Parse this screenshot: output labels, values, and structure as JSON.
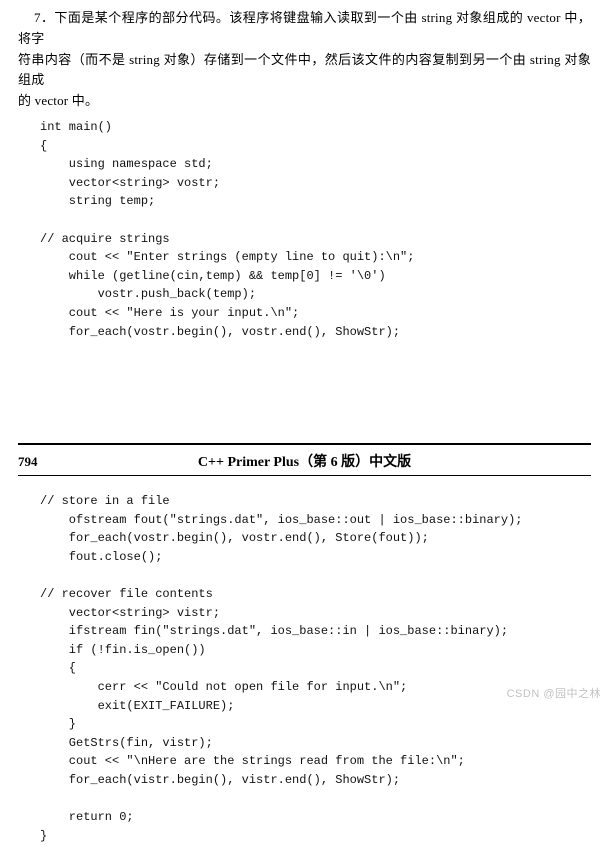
{
  "question": {
    "number": "7．",
    "line1": "下面是某个程序的部分代码。该程序将键盘输入读取到一个由 string 对象组成的 vector 中，将字",
    "line2": "符串内容（而不是 string 对象）存储到一个文件中，然后该文件的内容复制到另一个由 string 对象组成",
    "line3": "的 vector 中。"
  },
  "code1": "int main()\n{\n    using namespace std;\n    vector<string> vostr;\n    string temp;\n\n// acquire strings\n    cout << \"Enter strings (empty line to quit):\\n\";\n    while (getline(cin,temp) && temp[0] != '\\0')\n        vostr.push_back(temp);\n    cout << \"Here is your input.\\n\";\n    for_each(vostr.begin(), vostr.end(), ShowStr);",
  "header": {
    "page_number": "794",
    "book_title": "C++ Primer Plus（第 6 版）中文版"
  },
  "code2": "// store in a file\n    ofstream fout(\"strings.dat\", ios_base::out | ios_base::binary);\n    for_each(vostr.begin(), vostr.end(), Store(fout));\n    fout.close();\n\n// recover file contents\n    vector<string> vistr;\n    ifstream fin(\"strings.dat\", ios_base::in | ios_base::binary);\n    if (!fin.is_open())\n    {\n        cerr << \"Could not open file for input.\\n\";\n        exit(EXIT_FAILURE);\n    }\n    GetStrs(fin, vistr);\n    cout << \"\\nHere are the strings read from the file:\\n\";\n    for_each(vistr.begin(), vistr.end(), ShowStr);\n\n    return 0;\n}",
  "watermark": "CSDN @园中之林"
}
